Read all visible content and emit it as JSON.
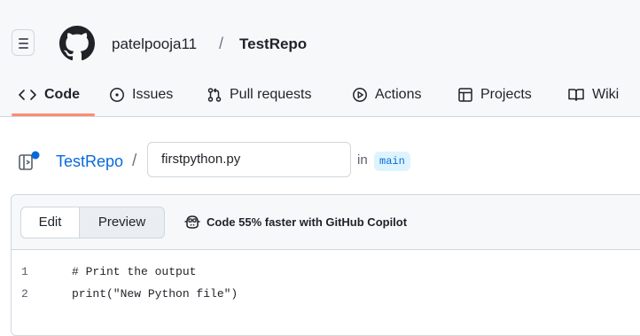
{
  "header": {
    "menu_icon": "hamburger-icon",
    "logo_icon": "github-logo",
    "owner": "patelpooja11",
    "separator": "/",
    "repo": "TestRepo"
  },
  "tabs": [
    {
      "label": "Code",
      "icon": "code-icon",
      "selected": true
    },
    {
      "label": "Issues",
      "icon": "issue-opened-icon"
    },
    {
      "label": "Pull requests",
      "icon": "git-pull-request-icon"
    },
    {
      "label": "Actions",
      "icon": "play-icon"
    },
    {
      "label": "Projects",
      "icon": "table-icon"
    },
    {
      "label": "Wiki",
      "icon": "book-icon"
    }
  ],
  "path": {
    "repo_link": "TestRepo",
    "separator": "/",
    "filename": "firstpython.py",
    "in_label": "in",
    "branch": "main"
  },
  "editor": {
    "edit_label": "Edit",
    "preview_label": "Preview",
    "copilot_label": "Code 55% faster with GitHub Copilot",
    "lines": [
      {
        "num": "1",
        "text": "# Print the output"
      },
      {
        "num": "2",
        "text": "print(\"New Python file\")"
      }
    ]
  },
  "colors": {
    "link": "#0969da",
    "tab_underline": "#fd8c73",
    "branch_bg": "#ddf4ff",
    "header_bg": "#f6f8fa"
  }
}
